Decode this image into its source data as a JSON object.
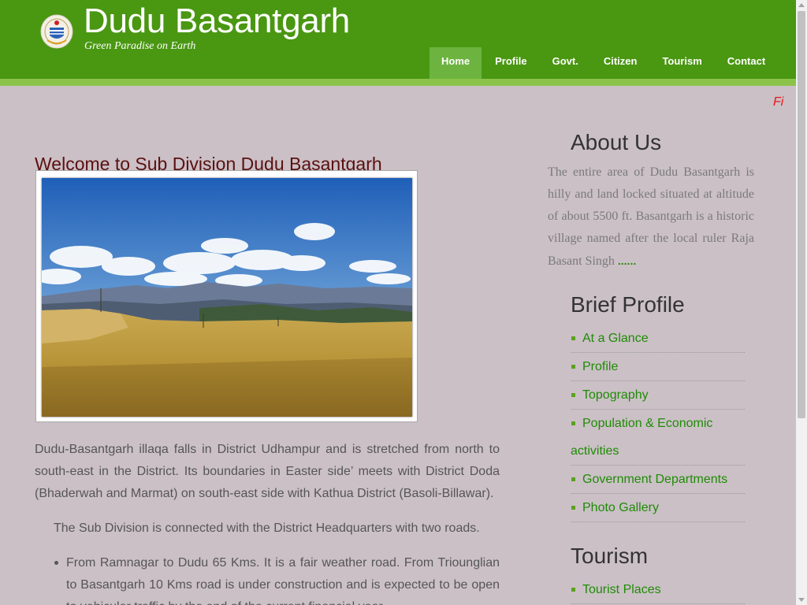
{
  "header": {
    "site_title": "Dudu Basantgarh",
    "tagline": "Green Paradise on Earth",
    "logo_icon": "state-emblem-icon",
    "colors": {
      "header_bg": "#4a9712",
      "active_nav": "#6db33f",
      "stripe": "#8bc34a"
    }
  },
  "nav": {
    "items": [
      {
        "label": "Home",
        "active": true
      },
      {
        "label": "Profile"
      },
      {
        "label": "Govt."
      },
      {
        "label": "Citizen"
      },
      {
        "label": "Tourism"
      },
      {
        "label": "Contact"
      }
    ]
  },
  "marquee": {
    "text": "Fi",
    "color": "#e8151c"
  },
  "main": {
    "welcome_title": "Welcome to Sub Division Dudu Basantgarh",
    "photo_alt": "landscape-photo",
    "para1": "Dudu-Basantgarh illaqa falls in District Udhampur and is stretched from north to south-east in the District. Its boundaries in Easter side’ meets with District Doda (Bhaderwah and Marmat) on south-east side with Kathua District (Basoli-Billawar).",
    "para2": "The Sub Division is connected  with the District Headquarters with two roads.",
    "bullet1": "From Ramnagar to Dudu 65 Kms. It is a fair weather road. From Triounglian  to Basantgarh 10 Kms road is under construction and is expected to be open to vehicular traffic by the end of the current financial year."
  },
  "sidebar": {
    "about_title": "About Us",
    "about_text": "The entire area of  Dudu  Basantgarh is hilly and land locked  situated at altitude of about 5500 ft. Basantgarh is a historic village named  after the local  ruler  Raja Basant Singh",
    "about_more": "......",
    "brief_title": "Brief Profile",
    "brief_items": [
      "At a Glance",
      "Profile",
      "Topography",
      "Population & Economic",
      "Government Departments",
      "Photo Gallery"
    ],
    "brief_item_line2": "activities",
    "tourism_title": "Tourism",
    "tourism_items": [
      "Tourist Places"
    ]
  }
}
